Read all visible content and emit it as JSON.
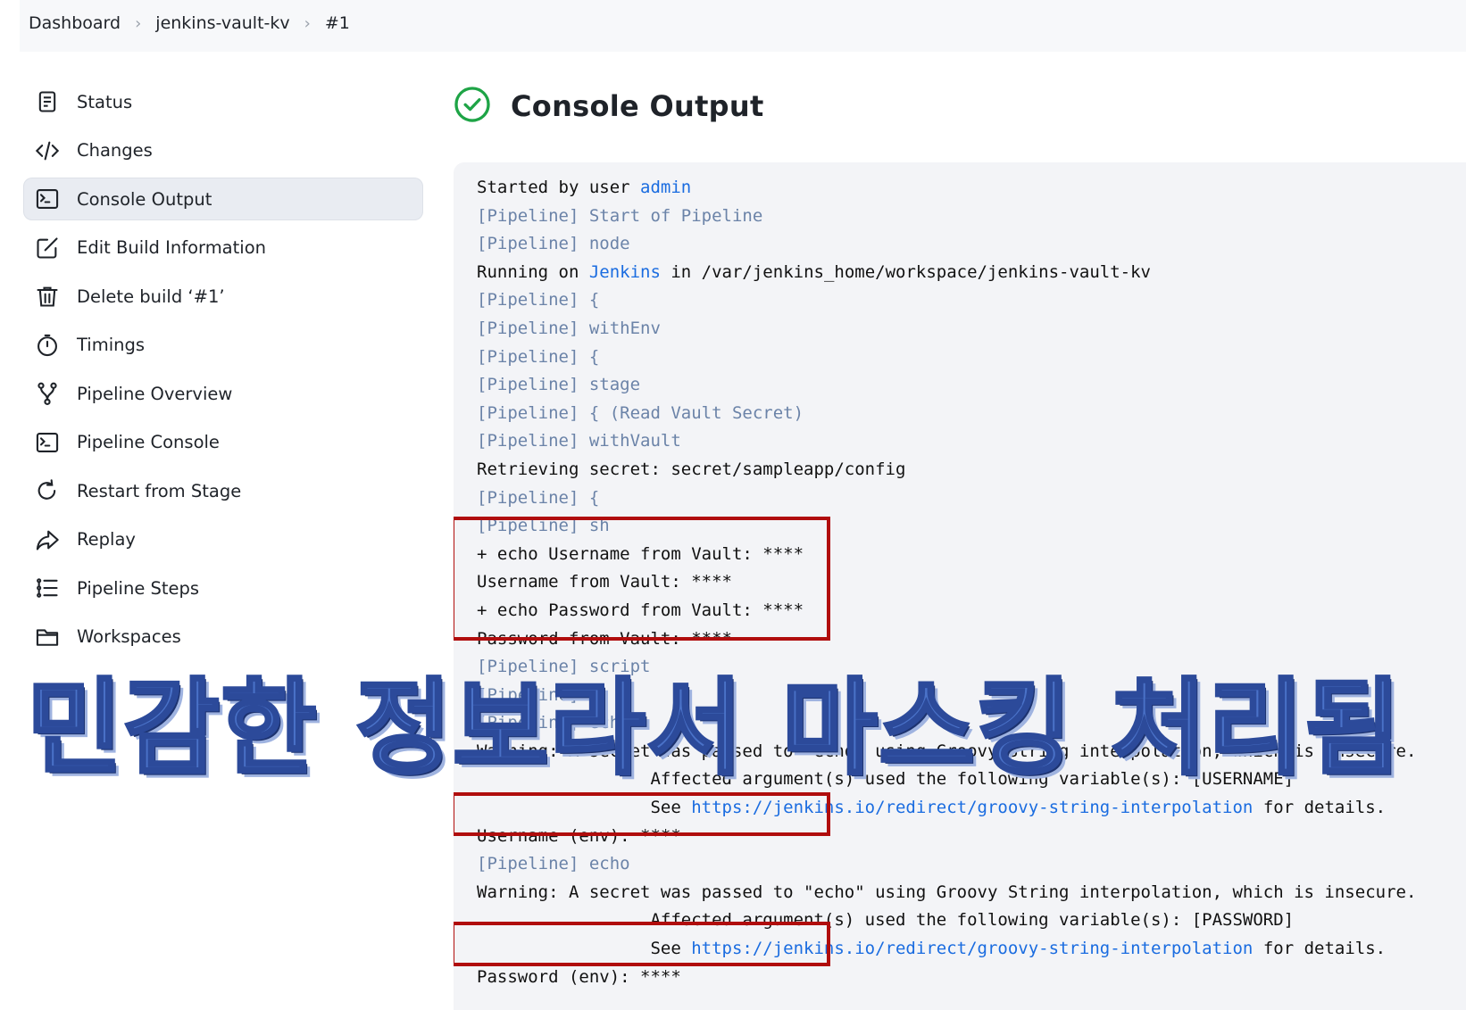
{
  "breadcrumb": [
    "Dashboard",
    "jenkins-vault-kv",
    "#1"
  ],
  "sidebar": {
    "items": [
      {
        "label": "Status",
        "icon": "status-icon"
      },
      {
        "label": "Changes",
        "icon": "code-icon"
      },
      {
        "label": "Console Output",
        "icon": "terminal-icon",
        "active": true
      },
      {
        "label": "Edit Build Information",
        "icon": "edit-icon"
      },
      {
        "label": "Delete build ‘#1’",
        "icon": "trash-icon"
      },
      {
        "label": "Timings",
        "icon": "timer-icon"
      },
      {
        "label": "Pipeline Overview",
        "icon": "branch-icon"
      },
      {
        "label": "Pipeline Console",
        "icon": "terminal-icon"
      },
      {
        "label": "Restart from Stage",
        "icon": "restart-icon"
      },
      {
        "label": "Replay",
        "icon": "replay-icon"
      },
      {
        "label": "Pipeline Steps",
        "icon": "list-icon"
      },
      {
        "label": "Workspaces",
        "icon": "folder-icon"
      }
    ]
  },
  "main": {
    "title": "Console Output",
    "status_icon": "success-check-icon",
    "status_color": "#1ea446"
  },
  "console": {
    "lines": [
      {
        "t": "Started by user ",
        "link": "admin"
      },
      {
        "t": "[Pipeline] Start of Pipeline",
        "pl": true
      },
      {
        "t": "[Pipeline] node",
        "pl": true
      },
      {
        "t": "Running on ",
        "link": "Jenkins",
        "after": " in /var/jenkins_home/workspace/jenkins-vault-kv"
      },
      {
        "t": "[Pipeline] {",
        "pl": true
      },
      {
        "t": "[Pipeline] withEnv",
        "pl": true
      },
      {
        "t": "[Pipeline] {",
        "pl": true
      },
      {
        "t": "[Pipeline] stage",
        "pl": true
      },
      {
        "t": "[Pipeline] { (Read Vault Secret)",
        "pl": true
      },
      {
        "t": "[Pipeline] withVault",
        "pl": true
      },
      {
        "t": "Retrieving secret: secret/sampleapp/config"
      },
      {
        "t": "[Pipeline] {",
        "pl": true
      },
      {
        "t": "[Pipeline] sh",
        "pl": true
      },
      {
        "t": "+ echo Username from Vault: ****"
      },
      {
        "t": "Username from Vault: ****"
      },
      {
        "t": "+ echo Password from Vault: ****"
      },
      {
        "t": "Password from Vault: ****"
      },
      {
        "t": "[Pipeline] script",
        "pl": true
      },
      {
        "t": "[Pipeline] {",
        "pl": true
      },
      {
        "t": "[Pipeline] echo",
        "pl": true
      },
      {
        "t": "Warning: A secret was passed to \"echo\" using Groovy String interpolation, which is insecure."
      },
      {
        "t": "                 Affected argument(s) used the following variable(s): [USERNAME]"
      },
      {
        "t": "                 See ",
        "link": "https://jenkins.io/redirect/groovy-string-interpolation",
        "after": " for details."
      },
      {
        "t": "Username (env): ****"
      },
      {
        "t": "[Pipeline] echo",
        "pl": true
      },
      {
        "t": "Warning: A secret was passed to \"echo\" using Groovy String interpolation, which is insecure."
      },
      {
        "t": "                 Affected argument(s) used the following variable(s): [PASSWORD]"
      },
      {
        "t": "                 See ",
        "link": "https://jenkins.io/redirect/groovy-string-interpolation",
        "after": " for details."
      },
      {
        "t": "Password (env): ****"
      }
    ]
  },
  "overlay_caption": "민감한 정보라서 마스킹 처리됨",
  "highlight_color": "#b00d0d"
}
